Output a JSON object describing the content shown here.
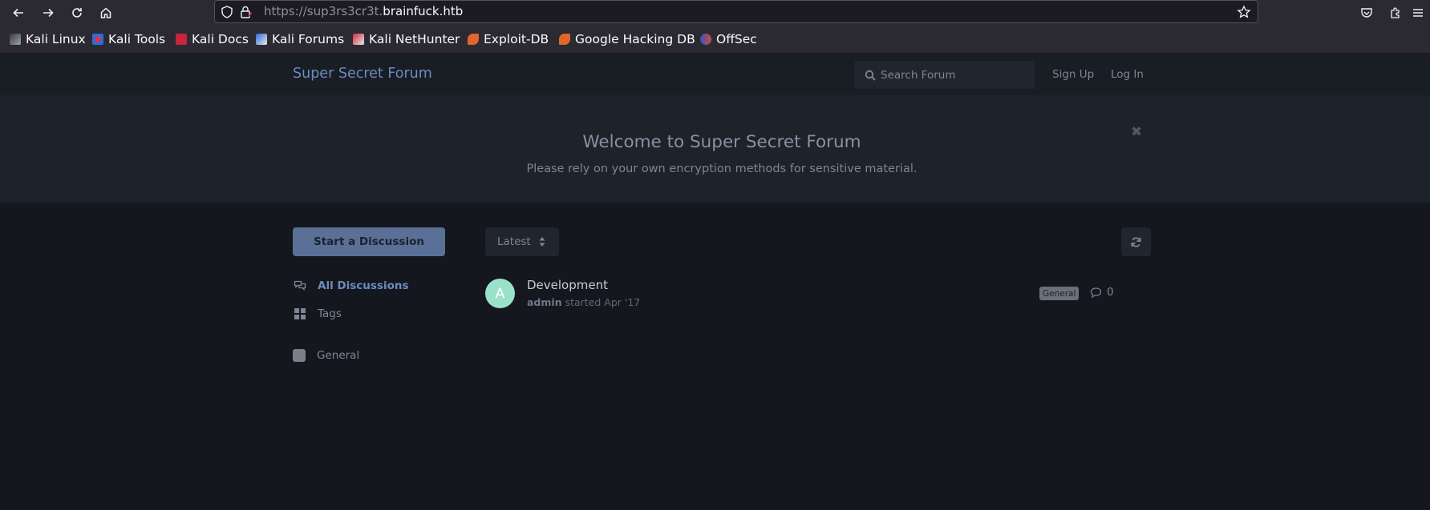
{
  "browser": {
    "url_prefix": "https://sup3rs3cr3t.",
    "url_domain": "brainfuck.htb",
    "bookmarks": [
      {
        "label": "Kali Linux",
        "icon": "kali-dragon-icon"
      },
      {
        "label": "Kali Tools",
        "icon": "kali-tools-icon"
      },
      {
        "label": "Kali Docs",
        "icon": "kali-docs-icon"
      },
      {
        "label": "Kali Forums",
        "icon": "kali-forums-icon"
      },
      {
        "label": "Kali NetHunter",
        "icon": "kali-nethunter-icon"
      },
      {
        "label": "Exploit-DB",
        "icon": "exploit-db-icon"
      },
      {
        "label": "Google Hacking DB",
        "icon": "ghdb-icon"
      },
      {
        "label": "OffSec",
        "icon": "offsec-icon"
      }
    ]
  },
  "header": {
    "brand": "Super Secret Forum",
    "search_placeholder": "Search Forum",
    "sign_up": "Sign Up",
    "log_in": "Log In"
  },
  "hero": {
    "title": "Welcome to Super Secret Forum",
    "subtitle": "Please rely on your own encryption methods for sensitive material."
  },
  "sidebar": {
    "start_button": "Start a Discussion",
    "nav": [
      {
        "label": "All Discussions",
        "icon": "comments-icon",
        "active": true
      },
      {
        "label": "Tags",
        "icon": "grid-icon",
        "active": false
      }
    ],
    "tags": [
      {
        "label": "General",
        "color": "#7a7f88"
      }
    ]
  },
  "main": {
    "sort_label": "Latest",
    "discussions": [
      {
        "avatar_letter": "A",
        "avatar_color": "#99e2c9",
        "title": "Development",
        "author": "admin",
        "started_text": "started Apr '17",
        "tag": "General",
        "reply_count": "0"
      }
    ]
  }
}
